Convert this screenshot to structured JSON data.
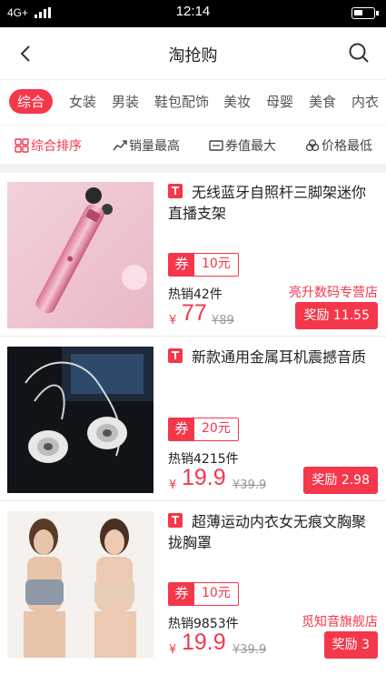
{
  "status_bar": {
    "network": "4G+",
    "time": "12:14"
  },
  "header": {
    "title": "淘抢购"
  },
  "categories": [
    "综合",
    "女装",
    "男装",
    "鞋包配饰",
    "美妆",
    "母婴",
    "美食",
    "内衣"
  ],
  "sorts": [
    "综合排序",
    "销量最高",
    "券值最大",
    "价格最低"
  ],
  "products": [
    {
      "title": "无线蓝牙自照杆三脚架迷你直播支架",
      "coupon_label": "券",
      "coupon_amount": "10元",
      "sold": "热销42件",
      "store": "亮升数码专营店",
      "currency": "¥",
      "price": "77",
      "original_price": "¥89",
      "reward": "奖励 11.55"
    },
    {
      "title": "新款通用金属耳机震撼音质",
      "coupon_label": "券",
      "coupon_amount": "20元",
      "sold": "热销4215件",
      "store": "",
      "currency": "¥",
      "price": "19.9",
      "original_price": "¥39.9",
      "reward": "奖励 2.98"
    },
    {
      "title": "超薄运动内衣女无痕文胸聚拢胸罩",
      "coupon_label": "券",
      "coupon_amount": "10元",
      "sold": "热销9853件",
      "store": "觅知音旗舰店",
      "currency": "¥",
      "price": "19.9",
      "original_price": "¥39.9",
      "reward": "奖励 3"
    }
  ],
  "colors": {
    "accent": "#f4374b"
  }
}
